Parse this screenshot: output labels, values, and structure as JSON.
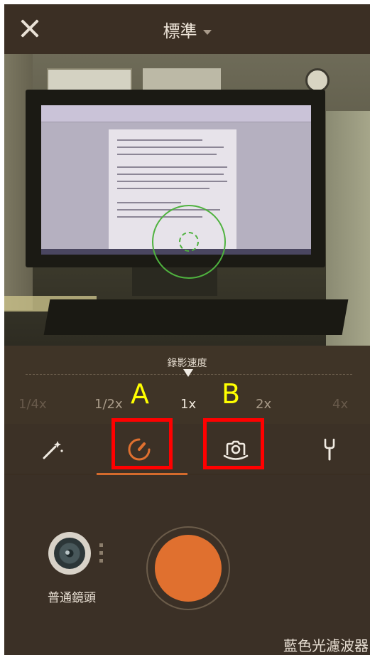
{
  "header": {
    "close_icon": "close-icon",
    "mode_label": "標準"
  },
  "speed": {
    "title": "錄影速度",
    "options": [
      "1/4x",
      "1/2x",
      "1x",
      "2x",
      "4x"
    ],
    "selected": "1x"
  },
  "tools": [
    {
      "icon": "magic-wand-icon",
      "selected": false
    },
    {
      "icon": "speed-dial-icon",
      "selected": true
    },
    {
      "icon": "camera-rotate-icon",
      "selected": false
    },
    {
      "icon": "wrench-icon",
      "selected": false
    }
  ],
  "annotations": {
    "a_label": "A",
    "b_label": "B",
    "box_color": "#ff0000",
    "letter_color": "#ffff00"
  },
  "bottom": {
    "lens_label": "普通鏡頭",
    "filter_label": "藍色光濾波器"
  },
  "colors": {
    "accent": "#e0702f",
    "focus": "#4fb23f",
    "panel_bg": "#3b3026"
  }
}
